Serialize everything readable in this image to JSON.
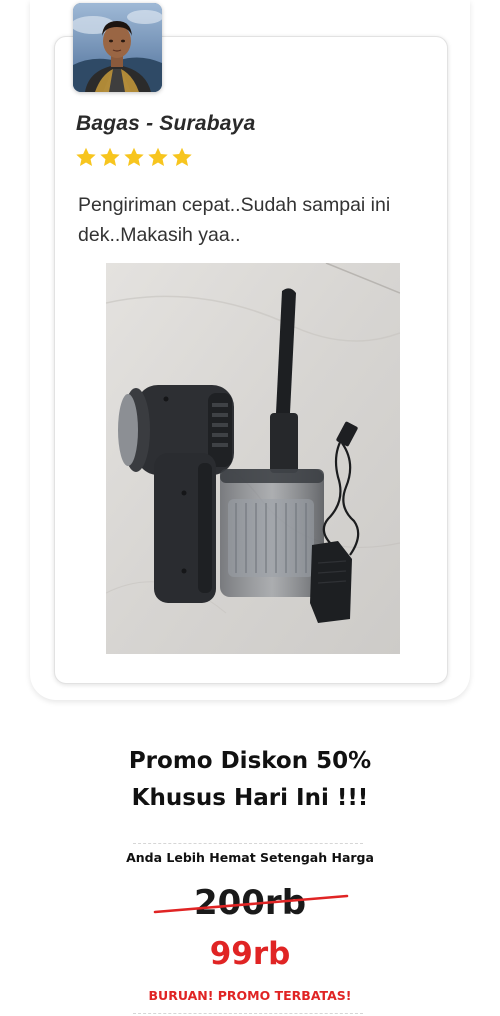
{
  "review": {
    "reviewer_name": "Bagas - Surabaya",
    "rating": 5,
    "max_rating": 5,
    "text": "Pengiriman cepat..Sudah sampai ini dek..Makasih yaa.."
  },
  "promo": {
    "title_line1": "Promo Diskon 50%",
    "title_line2": "Khusus Hari Ini !!!",
    "savings_text": "Anda Lebih Hemat Setengah Harga",
    "old_price": "200rb",
    "new_price": "99rb",
    "urgency_text": "BURUAN! PROMO TERBATAS!"
  },
  "colors": {
    "star": "#f7c51e",
    "price_red": "#e02424"
  }
}
